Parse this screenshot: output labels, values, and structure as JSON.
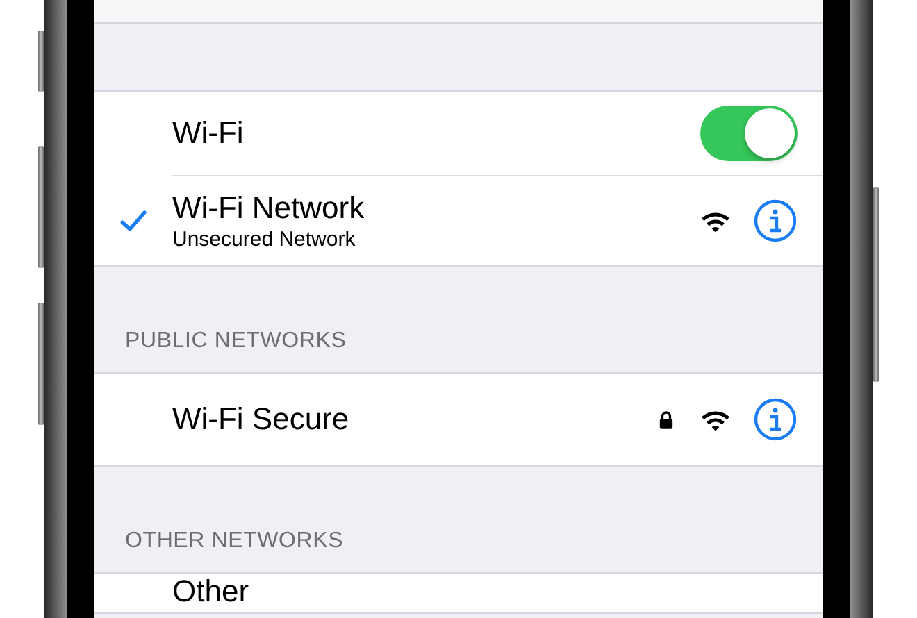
{
  "wifi_toggle": {
    "label": "Wi-Fi",
    "on": true
  },
  "current_network": {
    "name": "Wi-Fi Network",
    "subtitle": "Unsecured Network",
    "selected": true
  },
  "sections": [
    {
      "header": "PUBLIC NETWORKS",
      "networks": [
        {
          "name": "Wi-Fi Secure",
          "selected": false,
          "secured": true,
          "kind": "network"
        }
      ]
    },
    {
      "header": "OTHER NETWORKS",
      "networks": [
        {
          "name": "Other",
          "kind": "other"
        }
      ]
    }
  ]
}
